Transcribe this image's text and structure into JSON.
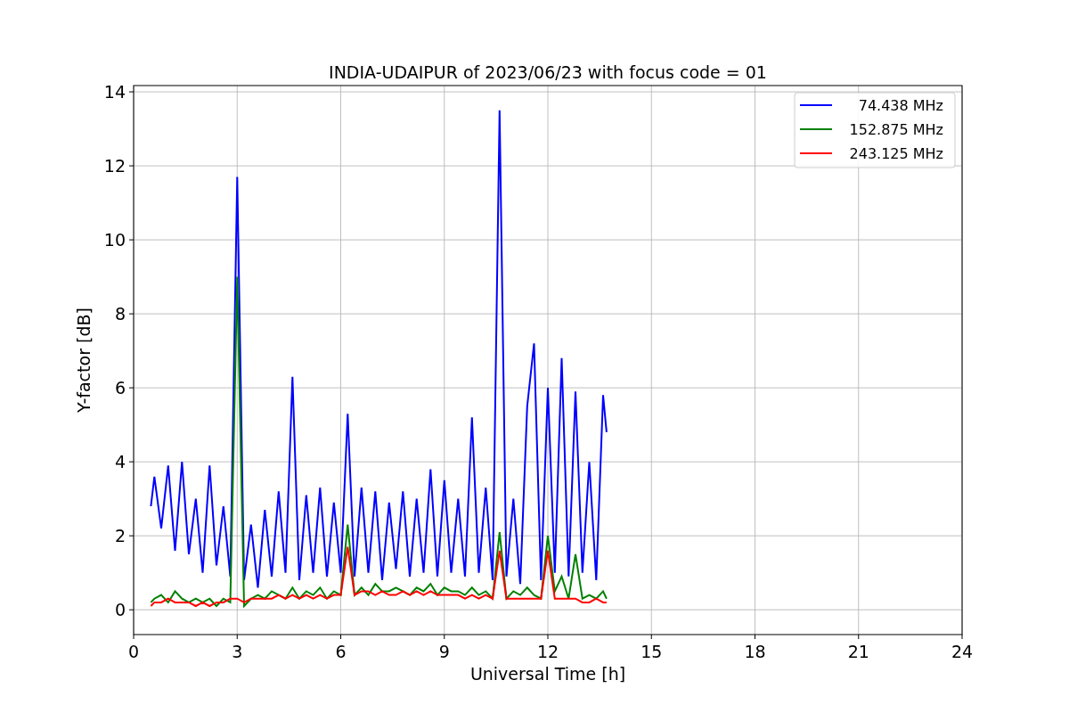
{
  "chart_data": {
    "type": "line",
    "title": "INDIA-UDAIPUR of 2023/06/23 with focus code = 01",
    "xlabel": "Universal Time [h]",
    "ylabel": "Y-factor [dB]",
    "x": [
      0.5,
      0.6,
      0.8,
      1.0,
      1.2,
      1.4,
      1.6,
      1.8,
      2.0,
      2.2,
      2.4,
      2.6,
      2.8,
      3.0,
      3.2,
      3.4,
      3.6,
      3.8,
      4.0,
      4.2,
      4.4,
      4.6,
      4.8,
      5.0,
      5.2,
      5.4,
      5.6,
      5.8,
      6.0,
      6.2,
      6.4,
      6.6,
      6.8,
      7.0,
      7.2,
      7.4,
      7.6,
      7.8,
      8.0,
      8.2,
      8.4,
      8.6,
      8.8,
      9.0,
      9.2,
      9.4,
      9.6,
      9.8,
      10.0,
      10.2,
      10.4,
      10.6,
      10.8,
      11.0,
      11.2,
      11.4,
      11.6,
      11.8,
      12.0,
      12.2,
      12.4,
      12.6,
      12.8,
      13.0,
      13.2,
      13.4,
      13.6,
      13.7
    ],
    "series": [
      {
        "name": " 74.438 MHz",
        "color": "#0000ff",
        "values": [
          2.8,
          3.6,
          2.2,
          3.9,
          1.6,
          4.0,
          1.5,
          3.0,
          1.0,
          3.9,
          1.2,
          2.8,
          0.9,
          11.7,
          0.8,
          2.3,
          0.6,
          2.7,
          0.9,
          3.2,
          1.0,
          6.3,
          0.8,
          3.1,
          1.0,
          3.3,
          0.9,
          2.9,
          1.0,
          5.3,
          0.9,
          3.3,
          1.0,
          3.2,
          0.8,
          2.9,
          1.1,
          3.2,
          0.9,
          3.0,
          1.0,
          3.8,
          0.9,
          3.5,
          1.0,
          3.0,
          0.9,
          5.2,
          1.0,
          3.3,
          0.8,
          13.5,
          0.9,
          3.0,
          0.7,
          5.5,
          7.2,
          0.8,
          6.0,
          1.0,
          6.8,
          0.9,
          5.9,
          1.0,
          4.0,
          0.8,
          5.8,
          4.8
        ]
      },
      {
        "name": "152.875 MHz",
        "color": "#008000",
        "values": [
          0.2,
          0.3,
          0.4,
          0.2,
          0.5,
          0.3,
          0.2,
          0.3,
          0.2,
          0.3,
          0.1,
          0.3,
          0.2,
          9.0,
          0.1,
          0.3,
          0.4,
          0.3,
          0.5,
          0.4,
          0.3,
          0.6,
          0.3,
          0.5,
          0.4,
          0.6,
          0.3,
          0.5,
          0.4,
          2.3,
          0.4,
          0.6,
          0.4,
          0.7,
          0.5,
          0.5,
          0.6,
          0.5,
          0.4,
          0.6,
          0.5,
          0.7,
          0.4,
          0.6,
          0.5,
          0.5,
          0.4,
          0.6,
          0.4,
          0.5,
          0.3,
          2.1,
          0.3,
          0.5,
          0.4,
          0.6,
          0.4,
          0.3,
          2.0,
          0.5,
          0.9,
          0.3,
          1.5,
          0.3,
          0.4,
          0.3,
          0.5,
          0.3
        ]
      },
      {
        "name": "243.125 MHz",
        "color": "#ff0000",
        "values": [
          0.1,
          0.2,
          0.2,
          0.3,
          0.2,
          0.2,
          0.2,
          0.1,
          0.2,
          0.1,
          0.2,
          0.2,
          0.3,
          0.3,
          0.2,
          0.3,
          0.3,
          0.3,
          0.3,
          0.4,
          0.3,
          0.4,
          0.3,
          0.4,
          0.3,
          0.4,
          0.3,
          0.4,
          0.4,
          1.7,
          0.4,
          0.5,
          0.5,
          0.4,
          0.5,
          0.4,
          0.4,
          0.5,
          0.4,
          0.5,
          0.4,
          0.5,
          0.4,
          0.4,
          0.4,
          0.4,
          0.3,
          0.4,
          0.3,
          0.4,
          0.3,
          1.6,
          0.3,
          0.3,
          0.3,
          0.3,
          0.3,
          0.3,
          1.6,
          0.3,
          0.3,
          0.3,
          0.3,
          0.2,
          0.2,
          0.3,
          0.2,
          0.2
        ]
      }
    ],
    "grid": true,
    "legend": true,
    "xlim": [
      0,
      24
    ],
    "ylim": [
      -0.67,
      14.17
    ],
    "xticks": [
      0,
      3,
      6,
      9,
      12,
      15,
      18,
      21,
      24
    ],
    "yticks": [
      0,
      2,
      4,
      6,
      8,
      10,
      12,
      14
    ]
  }
}
